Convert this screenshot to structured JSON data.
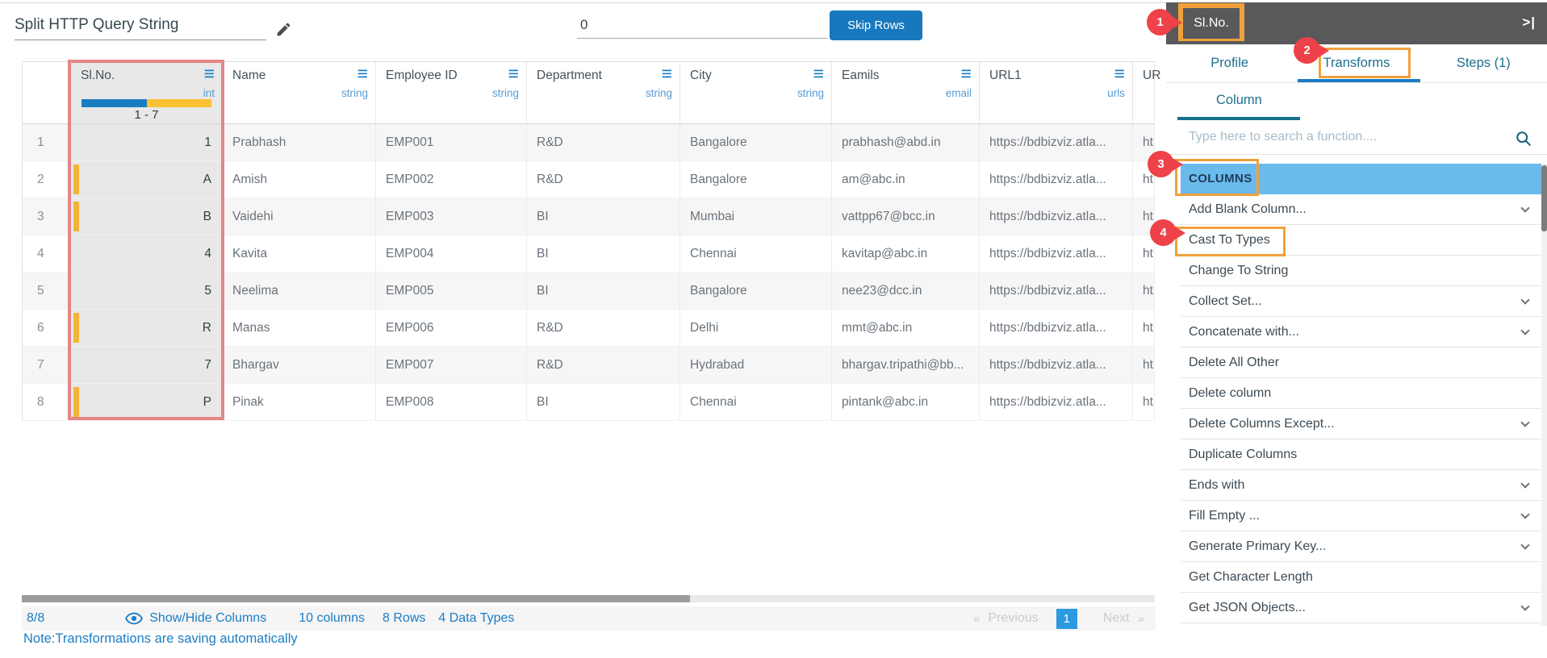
{
  "page": {
    "title": "Split HTTP Query String"
  },
  "toolbar": {
    "skip_value": "0",
    "skip_button_label": "Skip Rows"
  },
  "table": {
    "columns": [
      {
        "label": "Sl.No.",
        "type": "int",
        "range": "1 - 7"
      },
      {
        "label": "Name",
        "type": "string"
      },
      {
        "label": "Employee ID",
        "type": "string"
      },
      {
        "label": "Department",
        "type": "string"
      },
      {
        "label": "City",
        "type": "string"
      },
      {
        "label": "Eamils",
        "type": "email"
      },
      {
        "label": "URL1",
        "type": "urls"
      },
      {
        "label": "UR",
        "type": ""
      }
    ],
    "rows": [
      {
        "num": "1",
        "slno": "1",
        "flag": false,
        "name": "Prabhash",
        "emp": "EMP001",
        "dept": "R&D",
        "city": "Bangalore",
        "email": "prabhash@abd.in",
        "url1": "https://bdbizviz.atla...",
        "url2": "ht"
      },
      {
        "num": "2",
        "slno": "A",
        "flag": true,
        "name": "Amish",
        "emp": "EMP002",
        "dept": "R&D",
        "city": "Bangalore",
        "email": "am@abc.in",
        "url1": "https://bdbizviz.atla...",
        "url2": "ht"
      },
      {
        "num": "3",
        "slno": "B",
        "flag": true,
        "name": "Vaidehi",
        "emp": "EMP003",
        "dept": "BI",
        "city": "Mumbai",
        "email": "vattpp67@bcc.in",
        "url1": "https://bdbizviz.atla...",
        "url2": "ht"
      },
      {
        "num": "4",
        "slno": "4",
        "flag": false,
        "name": "Kavita",
        "emp": "EMP004",
        "dept": "BI",
        "city": "Chennai",
        "email": "kavitap@abc.in",
        "url1": "https://bdbizviz.atla...",
        "url2": "ht"
      },
      {
        "num": "5",
        "slno": "5",
        "flag": false,
        "name": "Neelima",
        "emp": "EMP005",
        "dept": "BI",
        "city": "Bangalore",
        "email": "nee23@dcc.in",
        "url1": "https://bdbizviz.atla...",
        "url2": "ht"
      },
      {
        "num": "6",
        "slno": "R",
        "flag": true,
        "name": "Manas",
        "emp": "EMP006",
        "dept": "R&D",
        "city": "Delhi",
        "email": "mmt@abc.in",
        "url1": "https://bdbizviz.atla...",
        "url2": "ht"
      },
      {
        "num": "7",
        "slno": "7",
        "flag": false,
        "name": "Bhargav",
        "emp": "EMP007",
        "dept": "R&D",
        "city": "Hydrabad",
        "email": "bhargav.tripathi@bb...",
        "url1": "https://bdbizviz.atla...",
        "url2": "ht"
      },
      {
        "num": "8",
        "slno": "P",
        "flag": true,
        "name": "Pinak",
        "emp": "EMP008",
        "dept": "BI",
        "city": "Chennai",
        "email": "pintank@abc.in",
        "url1": "https://bdbizviz.atla...",
        "url2": "ht"
      }
    ]
  },
  "footer": {
    "count": "8/8",
    "show_hide_label": "Show/Hide Columns",
    "columns_info": "10 columns",
    "rows_info": "8 Rows",
    "types_info": "4 Data Types",
    "prev_arrow": "«",
    "prev_label": "Previous",
    "page_number": "1",
    "next_label": "Next",
    "next_arrow": "»",
    "note": "Note:Transformations are saving automatically"
  },
  "panel": {
    "selected_column": "Sl.No.",
    "collapse_glyph": ">|",
    "tabs": [
      {
        "label": "Profile"
      },
      {
        "label": "Transforms"
      },
      {
        "label": "Steps (1)"
      }
    ],
    "subtab": "Column",
    "search_placeholder": "Type here to search a function....",
    "section_header": "COLUMNS",
    "functions": [
      {
        "label": "Add Blank Column...",
        "expandable": true
      },
      {
        "label": "Cast To Types",
        "expandable": false
      },
      {
        "label": "Change To String",
        "expandable": false
      },
      {
        "label": "Collect Set...",
        "expandable": true
      },
      {
        "label": "Concatenate with...",
        "expandable": true
      },
      {
        "label": "Delete All Other",
        "expandable": false
      },
      {
        "label": "Delete column",
        "expandable": false
      },
      {
        "label": "Delete Columns Except...",
        "expandable": true
      },
      {
        "label": "Duplicate Columns",
        "expandable": false
      },
      {
        "label": "Ends with",
        "expandable": true
      },
      {
        "label": "Fill Empty ...",
        "expandable": true
      },
      {
        "label": "Generate Primary Key...",
        "expandable": true
      },
      {
        "label": "Get Character Length",
        "expandable": false
      },
      {
        "label": "Get JSON Objects...",
        "expandable": true
      }
    ]
  },
  "annotations": [
    {
      "n": "1"
    },
    {
      "n": "2"
    },
    {
      "n": "3"
    },
    {
      "n": "4"
    }
  ],
  "colors": {
    "accent_blue": "#1a7dc4",
    "highlight_orange": "#f0a13c",
    "pin_red": "#ee4149",
    "columns_header_bg": "#6abaec",
    "histogram_yellow": "#fbc233",
    "column_border_red": "#e47c7c",
    "dark_bar": "#59595b",
    "page_box_blue": "#2b9ae0"
  }
}
